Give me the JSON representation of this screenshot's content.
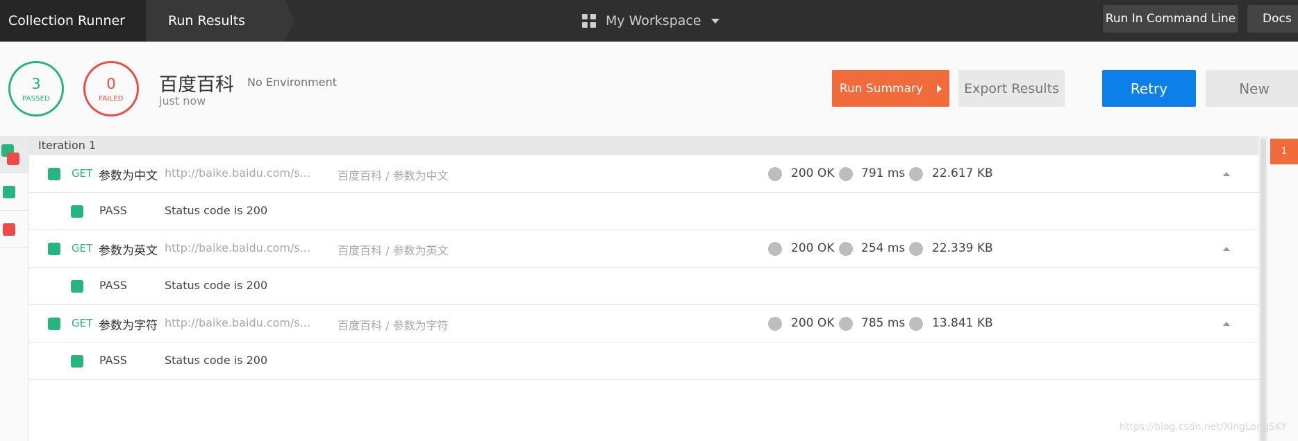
{
  "topbar": {
    "breadcrumb": [
      "Collection Runner",
      "Run Results"
    ],
    "workspace": "My Workspace",
    "run_cli_label": "Run In Command Line",
    "docs_label": "Docs"
  },
  "summary": {
    "passed_count": "3",
    "passed_label": "PASSED",
    "failed_count": "0",
    "failed_label": "FAILED",
    "collection_name": "百度百科",
    "environment": "No Environment",
    "time": "just now"
  },
  "buttons": {
    "run_summary": "Run Summary",
    "export_results": "Export Results",
    "retry": "Retry",
    "new": "New"
  },
  "iteration": {
    "label": "Iteration 1",
    "badge": "1"
  },
  "requests": [
    {
      "method": "GET",
      "name": "参数为中文",
      "url": "http://baike.baidu.com/s...",
      "path": "百度百科 / 参数为中文",
      "status": "200 OK",
      "time": "791 ms",
      "size": "22.617 KB",
      "test": {
        "status": "PASS",
        "name": "Status code is 200"
      }
    },
    {
      "method": "GET",
      "name": "参数为英文",
      "url": "http://baike.baidu.com/s...",
      "path": "百度百科 / 参数为英文",
      "status": "200 OK",
      "time": "254 ms",
      "size": "22.339 KB",
      "test": {
        "status": "PASS",
        "name": "Status code is 200"
      }
    },
    {
      "method": "GET",
      "name": "参数为字符",
      "url": "http://baike.baidu.com/s...",
      "path": "百度百科 / 参数为字符",
      "status": "200 OK",
      "time": "785 ms",
      "size": "13.841 KB",
      "test": {
        "status": "PASS",
        "name": "Status code is 200"
      }
    }
  ],
  "watermark": "https://blog.csdn.net/XingLongSKY",
  "colors": {
    "pass": "#26b47f",
    "fail": "#ed4b48",
    "accent_orange": "#f26b3a",
    "primary_blue": "#0c7fe8"
  }
}
